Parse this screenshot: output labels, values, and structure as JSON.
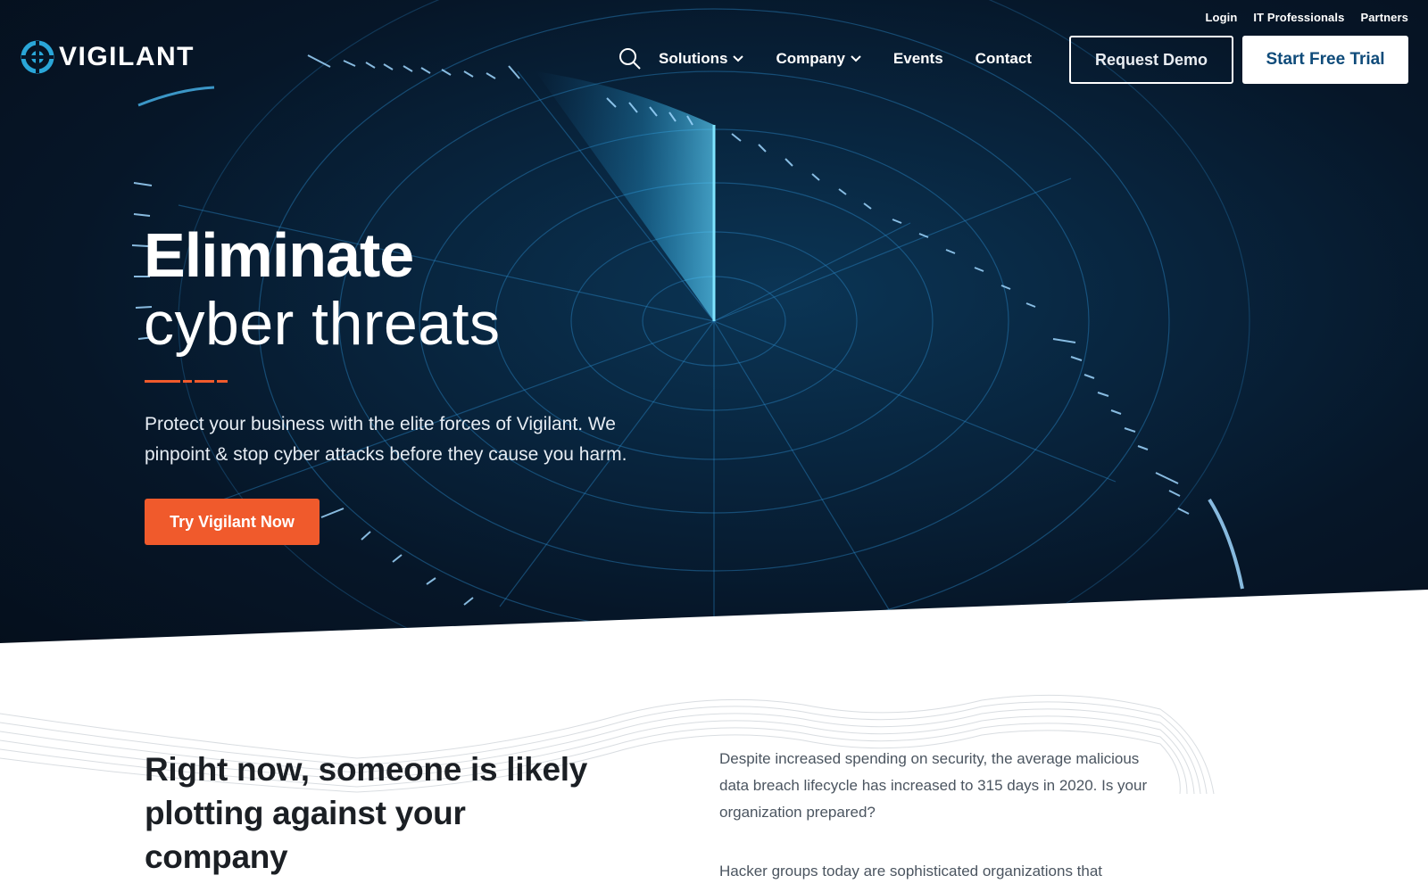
{
  "brand": {
    "name": "VIGILANT",
    "accent_color": "#f05a2c",
    "brand_blue": "#0f4b7a",
    "logo_color": "#2aa6d8"
  },
  "top_links": [
    "Login",
    "IT Professionals",
    "Partners"
  ],
  "nav": {
    "search_icon": "search-icon",
    "items": [
      {
        "label": "Solutions",
        "has_dropdown": true
      },
      {
        "label": "Company",
        "has_dropdown": true
      },
      {
        "label": "Events",
        "has_dropdown": false
      },
      {
        "label": "Contact",
        "has_dropdown": false
      }
    ],
    "request_demo_label": "Request Demo",
    "start_trial_label": "Start Free Trial"
  },
  "hero": {
    "title_bold": "Eliminate",
    "title_light": "cyber threats",
    "subtitle": "Protect your business with the elite forces of Vigilant. We pinpoint & stop cyber attacks before they cause you harm.",
    "cta_label": "Try Vigilant Now"
  },
  "section": {
    "heading": "Right now, someone is likely plotting against your company",
    "paragraph1": "Despite increased spending on security, the average malicious data breach lifecycle has increased to 315 days in 2020. Is your organization prepared?",
    "paragraph2": "Hacker groups today are sophisticated organizations that"
  }
}
